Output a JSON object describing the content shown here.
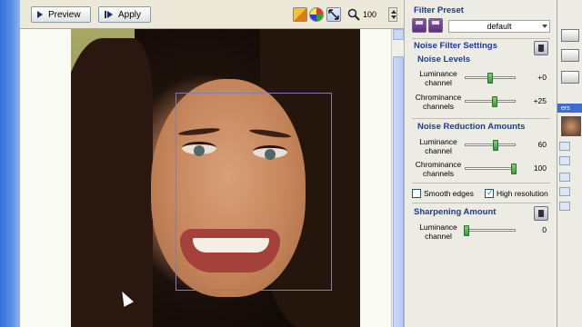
{
  "toolbar": {
    "preview_label": "Preview",
    "apply_label": "Apply",
    "zoom_value": "100"
  },
  "filter_preset": {
    "title": "Filter Preset",
    "selected": "default"
  },
  "noise_filter_settings": {
    "title": "Noise Filter Settings",
    "noise_levels_title": "Noise Levels",
    "luminance": {
      "label": "Luminance channel",
      "value": "+0",
      "level": 0.5
    },
    "chrominance": {
      "label": "Chrominance channels",
      "value": "+25",
      "level": 0.58
    }
  },
  "noise_reduction": {
    "title": "Noise Reduction Amounts",
    "luminance": {
      "label": "Luminance channel",
      "value": "60",
      "level": 0.6
    },
    "chrominance": {
      "label": "Chrominance channels",
      "value": "100",
      "level": 1.0
    }
  },
  "options": {
    "smooth_edges_label": "Smooth edges",
    "smooth_edges_checked": false,
    "high_resolution_label": "High resolution",
    "high_resolution_checked": true
  },
  "sharpening": {
    "title": "Sharpening Amount",
    "luminance": {
      "label": "Luminance channel",
      "value": "0",
      "level": 0.0
    }
  },
  "far_panel": {
    "tab_text": "ers"
  },
  "icons": [
    "play-icon",
    "step-icon",
    "layers-icon",
    "color-wheel-icon",
    "fit-screen-icon",
    "magnifier-icon",
    "save-preset-icon",
    "load-preset-icon",
    "trash-icon"
  ],
  "colors": {
    "section_title": "#1d3a9a",
    "slider_knob": "#3f9a3f",
    "xp_blue": "#2f6fd6"
  }
}
